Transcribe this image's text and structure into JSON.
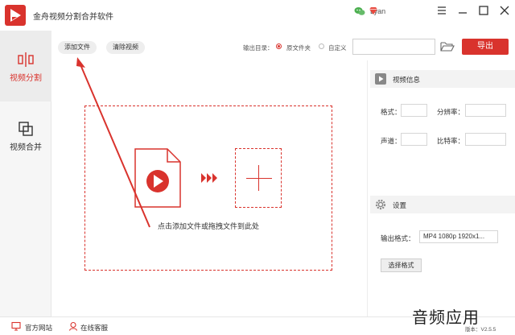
{
  "titlebar": {
    "title": "金舟视频分割合并软件",
    "user_name": "Lyan",
    "icons": [
      "app-logo",
      "wechat-icon",
      "vip-diamond-icon",
      "menu-icon",
      "minimize-icon",
      "maximize-icon",
      "close-icon"
    ]
  },
  "sidebar": {
    "items": [
      {
        "label": "视频分割",
        "icon": "split-icon",
        "active": true
      },
      {
        "label": "视频合并",
        "icon": "merge-icon",
        "active": false
      }
    ]
  },
  "toolbar": {
    "add_file": "添加文件",
    "clear_video": "清除视频",
    "output_dir_label": "输出目录：",
    "option_source": "原文件夹",
    "option_custom": "自定义",
    "selected_option": "原文件夹",
    "path_value": "",
    "export": "导出"
  },
  "dropzone": {
    "hint": "点击添加文件或拖拽文件到此处"
  },
  "video_info": {
    "title": "视频信息",
    "format_label": "格式：",
    "resolution_label": "分辨率：",
    "channel_label": "声道：",
    "bitrate_label": "比特率：",
    "format_value": "",
    "resolution_value": "",
    "channel_value": "",
    "bitrate_value": ""
  },
  "settings": {
    "title": "设置",
    "output_format_label": "输出格式：",
    "output_format_value": "MP4 1080p 1920x1...",
    "choose_format": "选择格式"
  },
  "statusbar": {
    "official_site": "官方网站",
    "online_service": "在线客服",
    "version": "版本：V2.5.5"
  },
  "watermark": "音频应用",
  "colors": {
    "accent": "#d9332d",
    "sidebar_bg": "#f6f6f6",
    "panel_head_bg": "#f3f3f3"
  }
}
